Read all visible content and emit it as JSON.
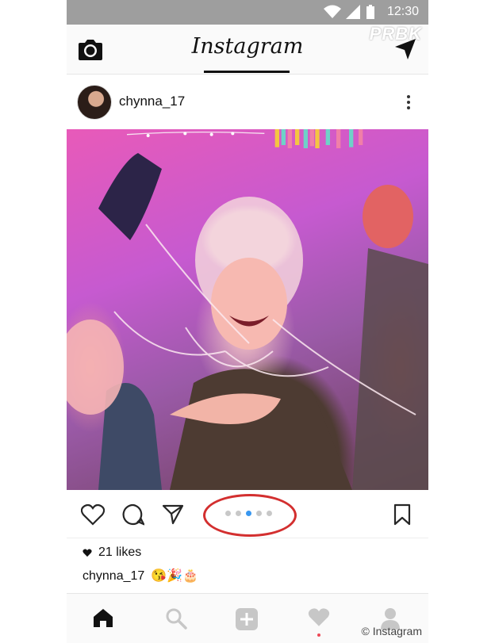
{
  "status_bar": {
    "time": "12:30"
  },
  "watermark_top": "PRBK",
  "app": {
    "title": "Instagram"
  },
  "post": {
    "username": "chynna_17",
    "likes_text": "21 likes",
    "caption_user": "chynna_17",
    "caption_emoji": "😘🎉🎂",
    "carousel": {
      "count": 5,
      "active_index": 2
    }
  },
  "footer_credit": "© Instagram",
  "colors": {
    "accent": "#3897f0",
    "annotation": "#d32f2f",
    "notification": "#ed4956"
  }
}
